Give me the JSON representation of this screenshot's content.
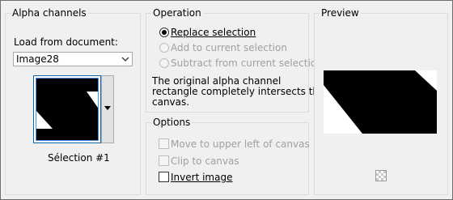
{
  "alpha": {
    "legend": "Alpha channels",
    "load_label": "Load from document:",
    "document_value": "Image28",
    "selection_name": "Sélection #1"
  },
  "operation": {
    "legend": "Operation",
    "options": [
      {
        "label": "Replace selection",
        "selected": true,
        "enabled": true
      },
      {
        "label": "Add to current selection",
        "selected": false,
        "enabled": false
      },
      {
        "label": "Subtract from current selection",
        "selected": false,
        "enabled": false
      }
    ],
    "message_line1": "The original alpha channel",
    "message_line2": "rectangle completely intersects the",
    "message_line3": "canvas."
  },
  "options": {
    "legend": "Options",
    "items": [
      {
        "label": "Move to upper left of canvas",
        "checked": false,
        "enabled": false
      },
      {
        "label": "Clip to canvas",
        "checked": false,
        "enabled": false
      },
      {
        "label": "Invert image",
        "checked": false,
        "enabled": true
      }
    ]
  },
  "preview": {
    "legend": "Preview"
  },
  "colors": {
    "focus_border": "#0a64ad",
    "panel_bg": "#f0f0f0",
    "disabled_text": "#a0a0a0"
  }
}
